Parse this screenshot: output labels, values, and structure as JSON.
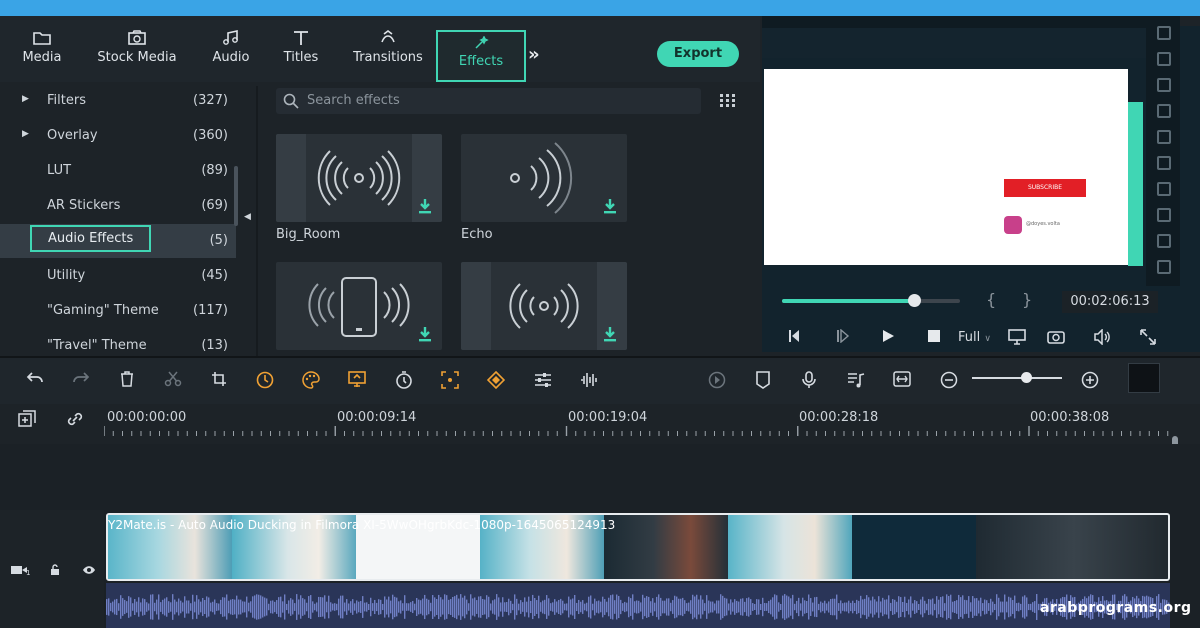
{
  "tabs": [
    {
      "label": "Media",
      "icon": "folder-icon"
    },
    {
      "label": "Stock Media",
      "icon": "stock-media-icon"
    },
    {
      "label": "Audio",
      "icon": "music-note-icon"
    },
    {
      "label": "Titles",
      "icon": "title-t-icon"
    },
    {
      "label": "Transitions",
      "icon": "transitions-icon"
    },
    {
      "label": "Effects",
      "icon": "effects-icon",
      "active": true
    }
  ],
  "more_label": "»",
  "export_label": "Export",
  "categories": [
    {
      "name": "Filters",
      "count": "(327)",
      "expandable": true
    },
    {
      "name": "Overlay",
      "count": "(360)",
      "expandable": true
    },
    {
      "name": "LUT",
      "count": "(89)"
    },
    {
      "name": "AR Stickers",
      "count": "(69)"
    },
    {
      "name": "Audio Effects",
      "count": "(5)",
      "selected": true
    },
    {
      "name": "Utility",
      "count": "(45)"
    },
    {
      "name": "\"Gaming\" Theme",
      "count": "(117)"
    },
    {
      "name": "\"Travel\" Theme",
      "count": "(13)"
    }
  ],
  "search": {
    "placeholder": "Search effects"
  },
  "effects": [
    {
      "label": "Big_Room"
    },
    {
      "label": "Echo"
    },
    {
      "label": ""
    },
    {
      "label": ""
    }
  ],
  "preview": {
    "subscribe_label": "SUBSCRIBE",
    "handle": "@doyes.volta",
    "timecode": "00:02:06:13",
    "progress": 0.74,
    "quality": "Full",
    "brace_open": "{",
    "brace_close": "}"
  },
  "ruler": [
    "00:00:00:00",
    "00:00:09:14",
    "00:00:19:04",
    "00:00:28:18",
    "00:00:38:08"
  ],
  "clip_title": "Y2Mate.is - Auto Audio Ducking in Filmora XI-5WwOHgrbKdc-1080p-1645065124913",
  "zoom": 0.6,
  "watermark": "arabprograms.org",
  "colors": {
    "accent": "#40d6b4",
    "background": "#1d2328",
    "subscribe": "#e21f26"
  }
}
